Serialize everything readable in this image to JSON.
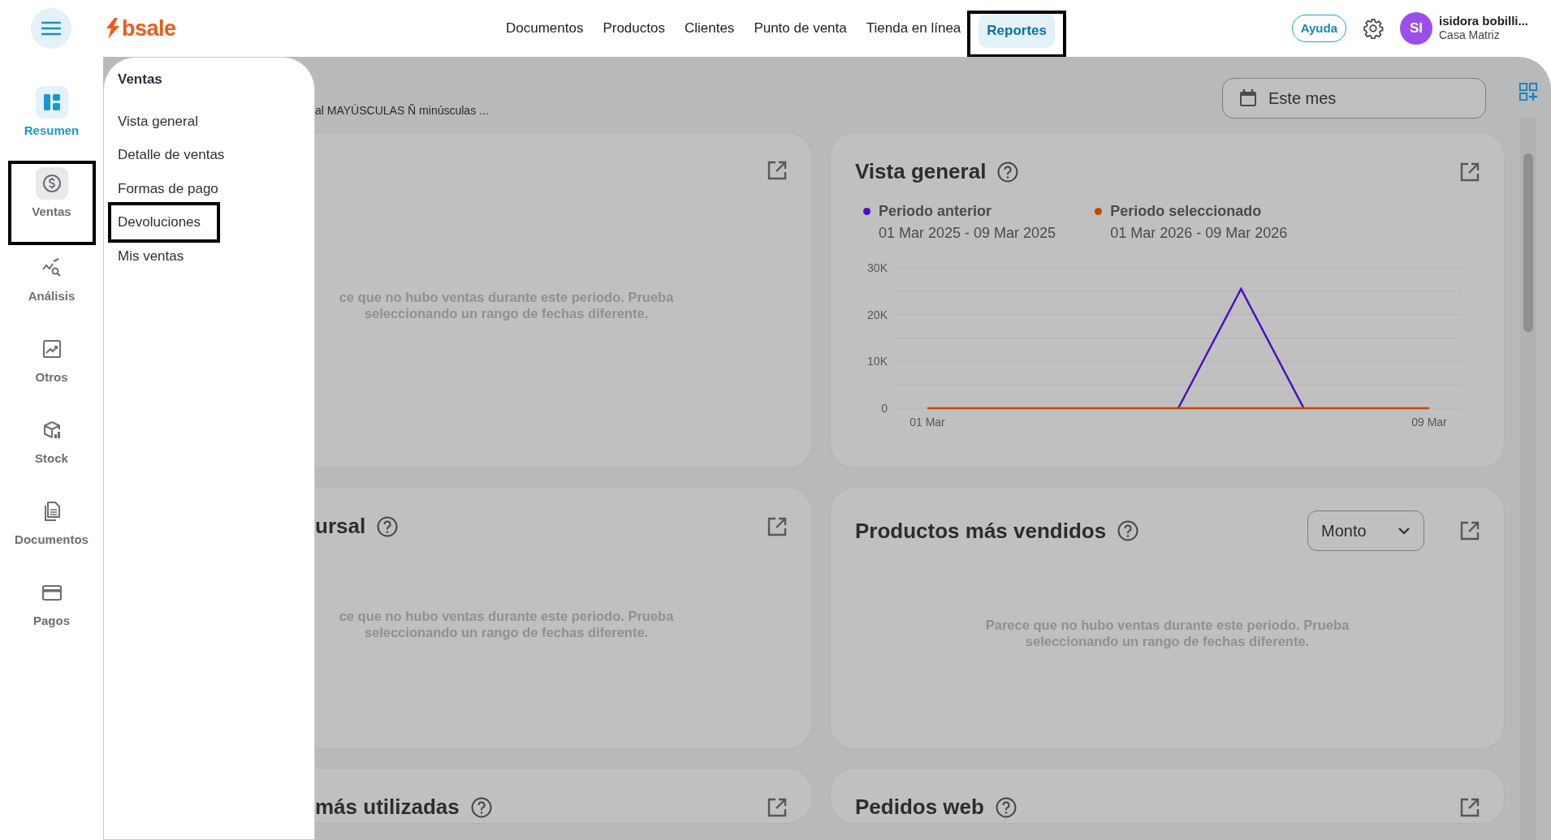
{
  "topbar": {
    "logo": "bsale",
    "nav": [
      {
        "label": "Documentos",
        "selected": false,
        "highlighted": false
      },
      {
        "label": "Productos",
        "selected": false,
        "highlighted": false
      },
      {
        "label": "Clientes",
        "selected": false,
        "highlighted": false
      },
      {
        "label": "Punto de venta",
        "selected": false,
        "highlighted": false
      },
      {
        "label": "Tienda en línea",
        "selected": false,
        "highlighted": false
      },
      {
        "label": "Reportes",
        "selected": true,
        "highlighted": true
      }
    ],
    "help_button": "Ayuda",
    "user": {
      "initials": "SI",
      "name": "isidora bobilli...",
      "branch": "Casa Matriz"
    }
  },
  "rail": [
    {
      "label": "Resumen",
      "kind": "dashboard",
      "selected": true,
      "open": false,
      "highlighted": false
    },
    {
      "label": "Ventas",
      "kind": "dollar",
      "selected": false,
      "open": true,
      "highlighted": true
    },
    {
      "label": "Análisis",
      "kind": "analysis",
      "selected": false,
      "open": false,
      "highlighted": false
    },
    {
      "label": "Otros",
      "kind": "chart",
      "selected": false,
      "open": false,
      "highlighted": false
    },
    {
      "label": "Stock",
      "kind": "box",
      "selected": false,
      "open": false,
      "highlighted": false
    },
    {
      "label": "Documentos",
      "kind": "document",
      "selected": false,
      "open": false,
      "highlighted": false
    },
    {
      "label": "Pagos",
      "kind": "card",
      "selected": false,
      "open": false,
      "highlighted": false
    }
  ],
  "flyout": {
    "title": "Ventas",
    "items": [
      {
        "label": "Vista general",
        "highlighted": false
      },
      {
        "label": "Detalle de ventas",
        "highlighted": false
      },
      {
        "label": "Formas de pago",
        "highlighted": false
      },
      {
        "label": "Devoluciones",
        "highlighted": true
      },
      {
        "label": "Mis ventas",
        "highlighted": false
      }
    ]
  },
  "main": {
    "subtitle": "al MAYÚSCULAS Ñ minúsculas ...",
    "date_filter": "Este mes",
    "cards": [
      {
        "help": false,
        "empty_message": "ce que no hubo ventas durante este periodo. Prueba seleccionando un rango de fechas diferente."
      },
      {
        "title": "Vista general",
        "help": true,
        "legend_dates": [
          "01 Mar 2025 - 09 Mar 2025",
          "01 Mar 2026 - 09 Mar 2026"
        ],
        "chart_data": {
          "type": "line",
          "categories": [
            "01 Mar",
            null,
            null,
            null,
            null,
            null,
            null,
            null,
            "09 Mar"
          ],
          "ylim": [
            0,
            30000
          ],
          "yticks": [
            {
              "value": 0,
              "label": "0"
            },
            {
              "value": 10000,
              "label": "10K"
            },
            {
              "value": 20000,
              "label": "20K"
            },
            {
              "value": 30000,
              "label": "30K"
            }
          ],
          "series": [
            {
              "name": "Periodo anterior",
              "color": "#4b0fbf",
              "values": [
                null,
                null,
                null,
                null,
                0,
                25500,
                0,
                null,
                null
              ]
            },
            {
              "name": "Periodo seleccionado",
              "color": "#c04a00",
              "values": [
                0,
                0,
                0,
                0,
                0,
                0,
                0,
                0,
                0
              ]
            }
          ]
        }
      },
      {
        "title": "ursal",
        "help": true,
        "empty_message": "ce que no hubo ventas durante este periodo. Prueba seleccionando un rango de fechas diferente."
      },
      {
        "title": "Productos más vendidos",
        "help": true,
        "dropdown": "Monto",
        "empty_message": "Parece que no hubo ventas durante este periodo. Prueba seleccionando un rango de fechas diferente."
      },
      {
        "title": "más utilizadas",
        "help": true
      },
      {
        "title": "Pedidos web",
        "help": true
      }
    ]
  }
}
